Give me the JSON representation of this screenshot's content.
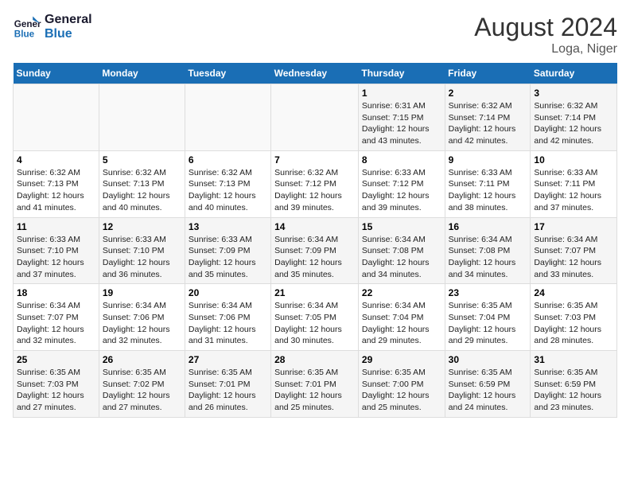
{
  "logo": {
    "line1": "General",
    "line2": "Blue"
  },
  "title": "August 2024",
  "location": "Loga, Niger",
  "days_header": [
    "Sunday",
    "Monday",
    "Tuesday",
    "Wednesday",
    "Thursday",
    "Friday",
    "Saturday"
  ],
  "weeks": [
    [
      {
        "day": "",
        "content": ""
      },
      {
        "day": "",
        "content": ""
      },
      {
        "day": "",
        "content": ""
      },
      {
        "day": "",
        "content": ""
      },
      {
        "day": "1",
        "content": "Sunrise: 6:31 AM\nSunset: 7:15 PM\nDaylight: 12 hours\nand 43 minutes."
      },
      {
        "day": "2",
        "content": "Sunrise: 6:32 AM\nSunset: 7:14 PM\nDaylight: 12 hours\nand 42 minutes."
      },
      {
        "day": "3",
        "content": "Sunrise: 6:32 AM\nSunset: 7:14 PM\nDaylight: 12 hours\nand 42 minutes."
      }
    ],
    [
      {
        "day": "4",
        "content": "Sunrise: 6:32 AM\nSunset: 7:13 PM\nDaylight: 12 hours\nand 41 minutes."
      },
      {
        "day": "5",
        "content": "Sunrise: 6:32 AM\nSunset: 7:13 PM\nDaylight: 12 hours\nand 40 minutes."
      },
      {
        "day": "6",
        "content": "Sunrise: 6:32 AM\nSunset: 7:13 PM\nDaylight: 12 hours\nand 40 minutes."
      },
      {
        "day": "7",
        "content": "Sunrise: 6:32 AM\nSunset: 7:12 PM\nDaylight: 12 hours\nand 39 minutes."
      },
      {
        "day": "8",
        "content": "Sunrise: 6:33 AM\nSunset: 7:12 PM\nDaylight: 12 hours\nand 39 minutes."
      },
      {
        "day": "9",
        "content": "Sunrise: 6:33 AM\nSunset: 7:11 PM\nDaylight: 12 hours\nand 38 minutes."
      },
      {
        "day": "10",
        "content": "Sunrise: 6:33 AM\nSunset: 7:11 PM\nDaylight: 12 hours\nand 37 minutes."
      }
    ],
    [
      {
        "day": "11",
        "content": "Sunrise: 6:33 AM\nSunset: 7:10 PM\nDaylight: 12 hours\nand 37 minutes."
      },
      {
        "day": "12",
        "content": "Sunrise: 6:33 AM\nSunset: 7:10 PM\nDaylight: 12 hours\nand 36 minutes."
      },
      {
        "day": "13",
        "content": "Sunrise: 6:33 AM\nSunset: 7:09 PM\nDaylight: 12 hours\nand 35 minutes."
      },
      {
        "day": "14",
        "content": "Sunrise: 6:34 AM\nSunset: 7:09 PM\nDaylight: 12 hours\nand 35 minutes."
      },
      {
        "day": "15",
        "content": "Sunrise: 6:34 AM\nSunset: 7:08 PM\nDaylight: 12 hours\nand 34 minutes."
      },
      {
        "day": "16",
        "content": "Sunrise: 6:34 AM\nSunset: 7:08 PM\nDaylight: 12 hours\nand 34 minutes."
      },
      {
        "day": "17",
        "content": "Sunrise: 6:34 AM\nSunset: 7:07 PM\nDaylight: 12 hours\nand 33 minutes."
      }
    ],
    [
      {
        "day": "18",
        "content": "Sunrise: 6:34 AM\nSunset: 7:07 PM\nDaylight: 12 hours\nand 32 minutes."
      },
      {
        "day": "19",
        "content": "Sunrise: 6:34 AM\nSunset: 7:06 PM\nDaylight: 12 hours\nand 32 minutes."
      },
      {
        "day": "20",
        "content": "Sunrise: 6:34 AM\nSunset: 7:06 PM\nDaylight: 12 hours\nand 31 minutes."
      },
      {
        "day": "21",
        "content": "Sunrise: 6:34 AM\nSunset: 7:05 PM\nDaylight: 12 hours\nand 30 minutes."
      },
      {
        "day": "22",
        "content": "Sunrise: 6:34 AM\nSunset: 7:04 PM\nDaylight: 12 hours\nand 29 minutes."
      },
      {
        "day": "23",
        "content": "Sunrise: 6:35 AM\nSunset: 7:04 PM\nDaylight: 12 hours\nand 29 minutes."
      },
      {
        "day": "24",
        "content": "Sunrise: 6:35 AM\nSunset: 7:03 PM\nDaylight: 12 hours\nand 28 minutes."
      }
    ],
    [
      {
        "day": "25",
        "content": "Sunrise: 6:35 AM\nSunset: 7:03 PM\nDaylight: 12 hours\nand 27 minutes."
      },
      {
        "day": "26",
        "content": "Sunrise: 6:35 AM\nSunset: 7:02 PM\nDaylight: 12 hours\nand 27 minutes."
      },
      {
        "day": "27",
        "content": "Sunrise: 6:35 AM\nSunset: 7:01 PM\nDaylight: 12 hours\nand 26 minutes."
      },
      {
        "day": "28",
        "content": "Sunrise: 6:35 AM\nSunset: 7:01 PM\nDaylight: 12 hours\nand 25 minutes."
      },
      {
        "day": "29",
        "content": "Sunrise: 6:35 AM\nSunset: 7:00 PM\nDaylight: 12 hours\nand 25 minutes."
      },
      {
        "day": "30",
        "content": "Sunrise: 6:35 AM\nSunset: 6:59 PM\nDaylight: 12 hours\nand 24 minutes."
      },
      {
        "day": "31",
        "content": "Sunrise: 6:35 AM\nSunset: 6:59 PM\nDaylight: 12 hours\nand 23 minutes."
      }
    ]
  ]
}
